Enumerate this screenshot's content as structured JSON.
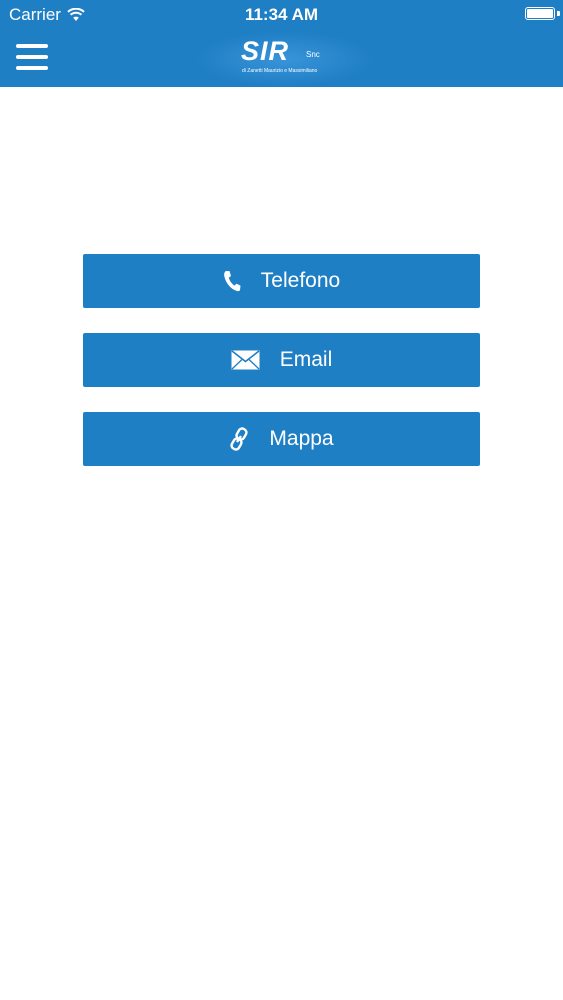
{
  "status_bar": {
    "carrier": "Carrier",
    "time": "11:34 AM"
  },
  "header": {
    "logo_main": "SIR",
    "logo_suffix": "Snc",
    "logo_subtitle": "di Zanetti Maurizio e Massimiliano"
  },
  "actions": [
    {
      "label": "Telefono",
      "icon": "phone-icon"
    },
    {
      "label": "Email",
      "icon": "mail-icon"
    },
    {
      "label": "Mappa",
      "icon": "link-icon"
    }
  ],
  "colors": {
    "primary": "#1f7fc4",
    "background": "#ffffff",
    "text_on_primary": "#ffffff"
  }
}
